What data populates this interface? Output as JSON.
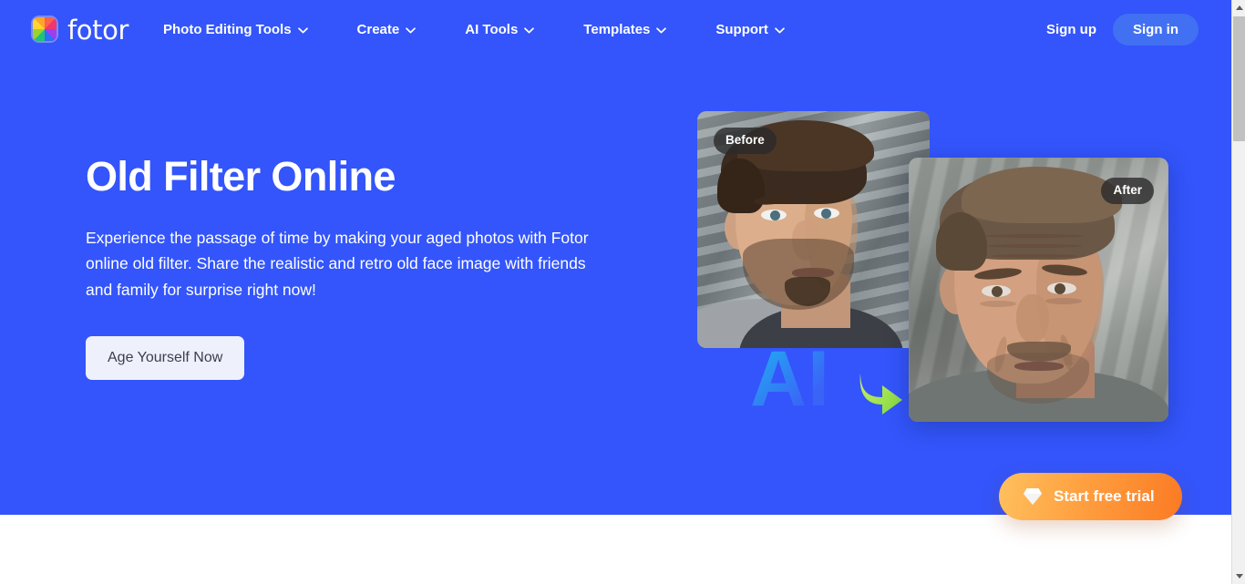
{
  "brand": {
    "name": "fotor",
    "logo_icon": "fotor-color-wheel-icon"
  },
  "nav": {
    "items": [
      {
        "label": "Photo Editing Tools",
        "icon": "chevron-down-icon"
      },
      {
        "label": "Create",
        "icon": "chevron-down-icon"
      },
      {
        "label": "AI Tools",
        "icon": "chevron-down-icon"
      },
      {
        "label": "Templates",
        "icon": "chevron-down-icon"
      },
      {
        "label": "Support",
        "icon": "chevron-down-icon"
      }
    ],
    "sign_up": "Sign up",
    "sign_in": "Sign in"
  },
  "hero": {
    "title": "Old Filter Online",
    "subtitle": "Experience the passage of time by making your aged photos with Fotor online old filter. Share the realistic and retro old face image with friends and family for surprise right now!",
    "cta": "Age Yourself Now",
    "ai_label": "AI",
    "arrow_icon": "curved-arrow-right-icon",
    "before_badge": "Before",
    "after_badge": "After"
  },
  "floating": {
    "trial_label": "Start free trial",
    "trial_icon": "diamond-gem-icon"
  },
  "colors": {
    "hero_background": "#3355fb",
    "signin_button": "#4170f2",
    "cta_button": "#eef0fb",
    "cta_text": "#3a3f4f",
    "trial_gradient_start": "#ffc05e",
    "trial_gradient_end": "#fb7a23",
    "badge_background": "#2a2a2a",
    "ai_gradient_start": "#1fb5f0",
    "ai_gradient_end": "#3a63f7",
    "arrow_green": "#a6e24a"
  },
  "scrollbar": {
    "up_icon": "scroll-up-arrow-icon",
    "down_icon": "scroll-down-arrow-icon"
  }
}
